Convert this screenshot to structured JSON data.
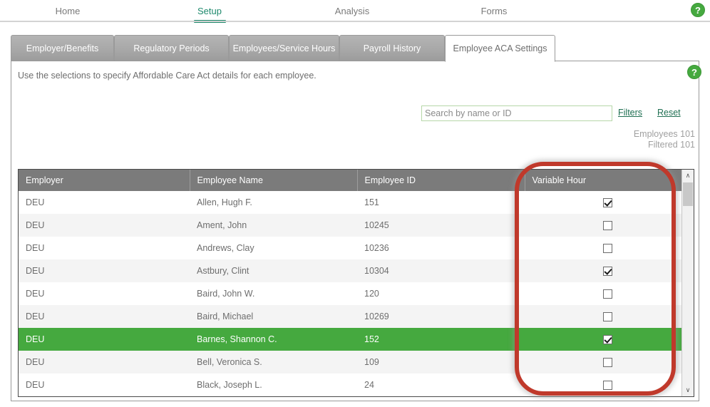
{
  "top_nav": {
    "items": [
      {
        "label": "Home",
        "active": false
      },
      {
        "label": "Setup",
        "active": true
      },
      {
        "label": "Analysis",
        "active": false
      },
      {
        "label": "Forms",
        "active": false
      }
    ],
    "help_icon": "help-icon",
    "help_glyph": "?"
  },
  "tabs": [
    {
      "label": "Employer/Benefits",
      "active": false
    },
    {
      "label": "Regulatory Periods",
      "active": false
    },
    {
      "label": "Employees/Service Hours",
      "active": false
    },
    {
      "label": "Payroll History",
      "active": false
    },
    {
      "label": "Employee ACA Settings",
      "active": true
    }
  ],
  "panel": {
    "instruction": "Use the selections to specify Affordable Care Act details for each employee.",
    "help_icon": "help-icon",
    "help_glyph": "?"
  },
  "search": {
    "value": "",
    "placeholder": "Search by name or ID",
    "filters_label": "Filters",
    "reset_label": "Reset"
  },
  "counts": {
    "employees_line": "Employees 101",
    "filtered_line": "Filtered 101"
  },
  "grid": {
    "columns": [
      "Employer",
      "Employee Name",
      "Employee ID",
      "Variable Hour"
    ],
    "rows": [
      {
        "employer": "DEU",
        "name": "Allen, Hugh F.",
        "id": "151",
        "variable_hour": true,
        "selected": false
      },
      {
        "employer": "DEU",
        "name": "Ament, John",
        "id": "10245",
        "variable_hour": false,
        "selected": false
      },
      {
        "employer": "DEU",
        "name": "Andrews, Clay",
        "id": "10236",
        "variable_hour": false,
        "selected": false
      },
      {
        "employer": "DEU",
        "name": "Astbury, Clint",
        "id": "10304",
        "variable_hour": true,
        "selected": false
      },
      {
        "employer": "DEU",
        "name": "Baird, John W.",
        "id": "120",
        "variable_hour": false,
        "selected": false
      },
      {
        "employer": "DEU",
        "name": "Baird, Michael",
        "id": "10269",
        "variable_hour": false,
        "selected": false
      },
      {
        "employer": "DEU",
        "name": "Barnes, Shannon C.",
        "id": "152",
        "variable_hour": true,
        "selected": true
      },
      {
        "employer": "DEU",
        "name": "Bell, Veronica S.",
        "id": "109",
        "variable_hour": false,
        "selected": false
      },
      {
        "employer": "DEU",
        "name": "Black, Joseph L.",
        "id": "24",
        "variable_hour": false,
        "selected": false
      }
    ],
    "scrollbar": {
      "up_glyph": "∧",
      "down_glyph": "∨"
    }
  },
  "annotation": {
    "shape": "rounded-rectangle-highlight",
    "color": "#c0392b",
    "target_column": "Variable Hour"
  },
  "colors": {
    "accent_green": "#1f8a6d",
    "selected_row_green": "#45a93f",
    "header_gray": "#7b7b7b",
    "tab_gray": "#a8a8a8",
    "annotation_red": "#c0392b"
  }
}
